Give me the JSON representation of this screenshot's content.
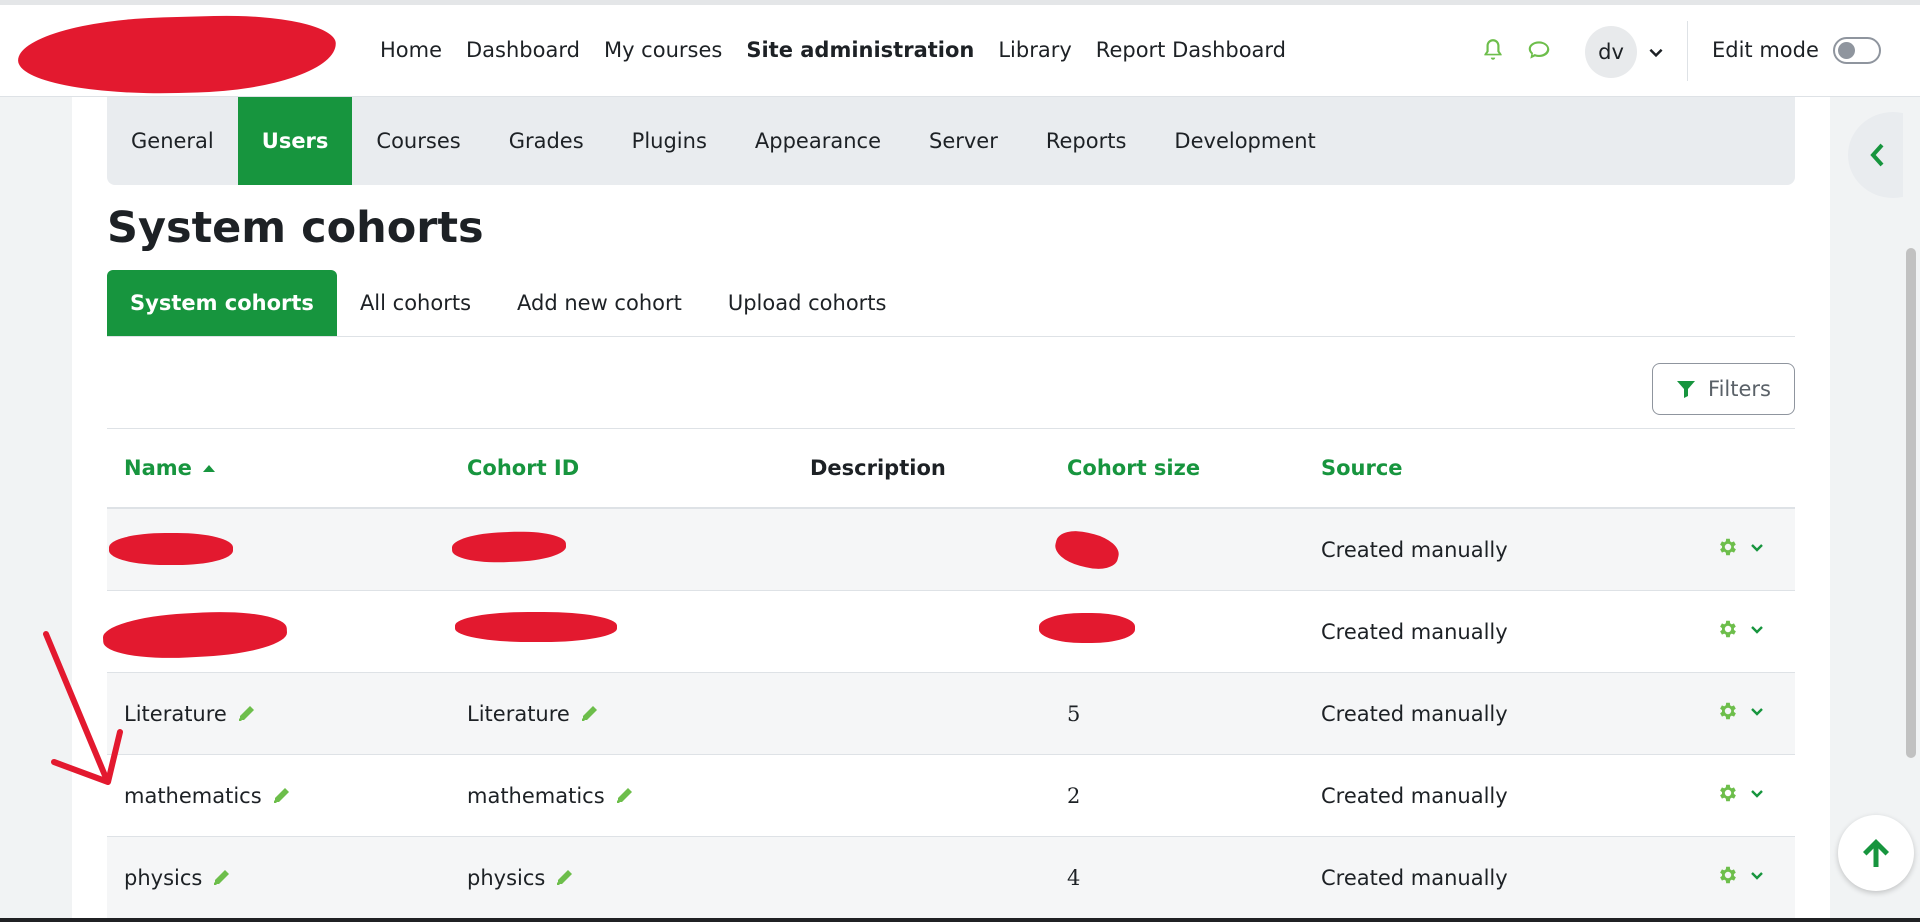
{
  "navbar": {
    "links": [
      "Home",
      "Dashboard",
      "My courses",
      "Site administration",
      "Library",
      "Report Dashboard"
    ],
    "active_link": "Site administration",
    "avatar_initials": "dv",
    "edit_mode_label": "Edit mode",
    "edit_mode_on": false
  },
  "secondary_nav": {
    "tabs": [
      "General",
      "Users",
      "Courses",
      "Grades",
      "Plugins",
      "Appearance",
      "Server",
      "Reports",
      "Development"
    ],
    "active_tab": "Users"
  },
  "page_title": "System cohorts",
  "tertiary_nav": {
    "tabs": [
      "System cohorts",
      "All cohorts",
      "Add new cohort",
      "Upload cohorts"
    ],
    "active_tab": "System cohorts"
  },
  "filters_button": "Filters",
  "table": {
    "headers": {
      "name": "Name",
      "cohort_id": "Cohort ID",
      "description": "Description",
      "cohort_size": "Cohort size",
      "source": "Source"
    },
    "sort_column": "Name",
    "rows": [
      {
        "name": "",
        "cohort_id": "",
        "description": "",
        "cohort_size": "",
        "source": "Created manually",
        "redacted": true
      },
      {
        "name": "",
        "cohort_id": "",
        "description": "",
        "cohort_size": "",
        "source": "Created manually",
        "redacted": true
      },
      {
        "name": "Literature",
        "cohort_id": "Literature",
        "description": "",
        "cohort_size": "5",
        "source": "Created manually",
        "redacted": false
      },
      {
        "name": "mathematics",
        "cohort_id": "mathematics",
        "description": "",
        "cohort_size": "2",
        "source": "Created manually",
        "redacted": false
      },
      {
        "name": "physics",
        "cohort_id": "physics",
        "description": "",
        "cohort_size": "4",
        "source": "Created manually",
        "redacted": false
      }
    ]
  },
  "colors": {
    "brand": "#17953e",
    "icon_green": "#6dbe4b",
    "redaction": "#e3192f",
    "annotation_arrow": "#e3192f"
  }
}
